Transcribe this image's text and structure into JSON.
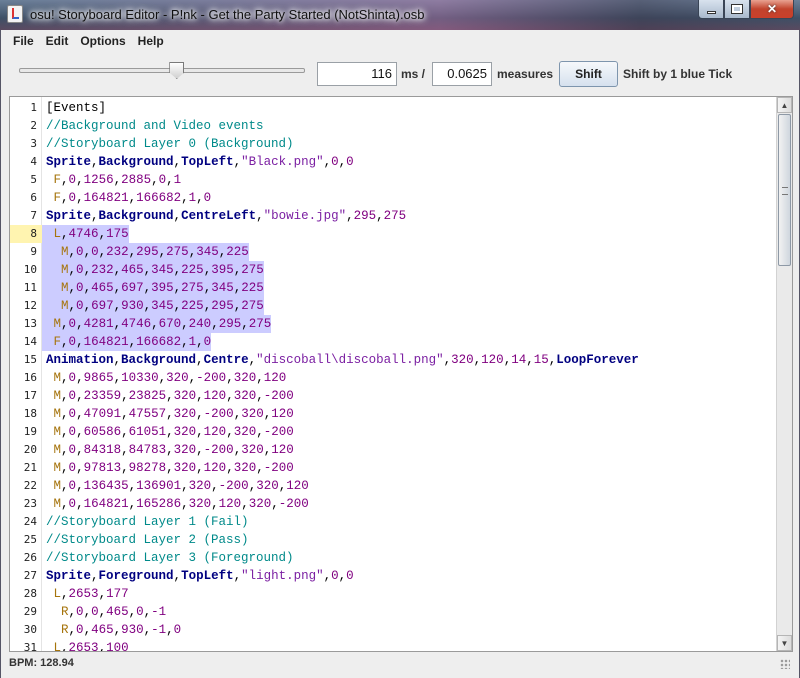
{
  "window": {
    "title": "osu! Storyboard Editor - P!nk - Get the Party Started (NotShinta).osb",
    "icons": {
      "app": "java-cup-icon",
      "minimize": "minimize-icon",
      "maximize": "maximize-icon",
      "close": "close-icon"
    }
  },
  "menu": {
    "items": [
      "File",
      "Edit",
      "Options",
      "Help"
    ]
  },
  "toolbar": {
    "slider_level": 0.55,
    "ms_value": "116",
    "ms_label": "ms /",
    "measures_value": "0.0625",
    "measures_label": "measures",
    "shift_button": "Shift",
    "shift_description": "Shift by 1 blue Tick"
  },
  "editor": {
    "current_line": 8,
    "selection": "lines 8-14",
    "colors": {
      "comment": "#008a8a",
      "keyword": "#000080",
      "number": "#800080",
      "selection": "#ccccff",
      "current_line_gutter": "#fff4b0"
    },
    "lines": [
      {
        "n": "1",
        "text": "[Events]"
      },
      {
        "n": "2",
        "text": "//Background and Video events"
      },
      {
        "n": "3",
        "text": "//Storyboard Layer 0 (Background)"
      },
      {
        "n": "4",
        "text": "Sprite,Background,TopLeft,\"Black.png\",0,0"
      },
      {
        "n": "5",
        "text": " F,0,1256,2885,0,1"
      },
      {
        "n": "6",
        "text": " F,0,164821,166682,1,0"
      },
      {
        "n": "7",
        "text": "Sprite,Background,CentreLeft,\"bowie.jpg\",295,275"
      },
      {
        "n": "8",
        "text": " L,4746,175"
      },
      {
        "n": "9",
        "text": "  M,0,0,232,295,275,345,225"
      },
      {
        "n": "10",
        "text": "  M,0,232,465,345,225,395,275"
      },
      {
        "n": "11",
        "text": "  M,0,465,697,395,275,345,225"
      },
      {
        "n": "12",
        "text": "  M,0,697,930,345,225,295,275"
      },
      {
        "n": "13",
        "text": " M,0,4281,4746,670,240,295,275"
      },
      {
        "n": "14",
        "text": " F,0,164821,166682,1,0"
      },
      {
        "n": "15",
        "text": "Animation,Background,Centre,\"discoball\\discoball.png\",320,120,14,15,LoopForever"
      },
      {
        "n": "16",
        "text": " M,0,9865,10330,320,-200,320,120"
      },
      {
        "n": "17",
        "text": " M,0,23359,23825,320,120,320,-200"
      },
      {
        "n": "18",
        "text": " M,0,47091,47557,320,-200,320,120"
      },
      {
        "n": "19",
        "text": " M,0,60586,61051,320,120,320,-200"
      },
      {
        "n": "20",
        "text": " M,0,84318,84783,320,-200,320,120"
      },
      {
        "n": "21",
        "text": " M,0,97813,98278,320,120,320,-200"
      },
      {
        "n": "22",
        "text": " M,0,136435,136901,320,-200,320,120"
      },
      {
        "n": "23",
        "text": " M,0,164821,165286,320,120,320,-200"
      },
      {
        "n": "24",
        "text": "//Storyboard Layer 1 (Fail)"
      },
      {
        "n": "25",
        "text": "//Storyboard Layer 2 (Pass)"
      },
      {
        "n": "26",
        "text": "//Storyboard Layer 3 (Foreground)"
      },
      {
        "n": "27",
        "text": "Sprite,Foreground,TopLeft,\"light.png\",0,0"
      },
      {
        "n": "28",
        "text": " L,2653,177"
      },
      {
        "n": "29",
        "text": "  R,0,0,465,0,-1"
      },
      {
        "n": "30",
        "text": "  R,0,465,930,-1,0"
      },
      {
        "n": "31",
        "text": " L,2653,100"
      }
    ]
  },
  "status": {
    "bpm": "BPM: 128.94"
  }
}
